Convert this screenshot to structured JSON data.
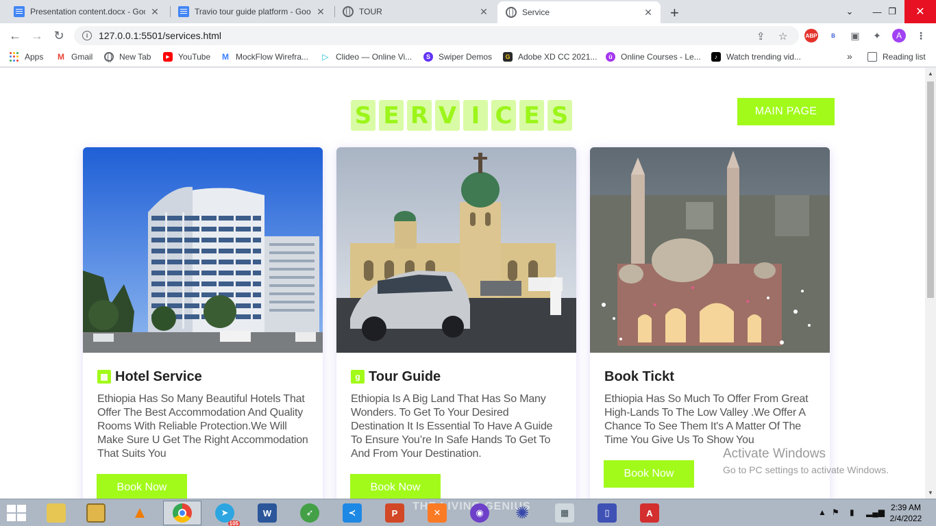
{
  "browser": {
    "tabs": [
      {
        "title": "Presentation content.docx - Goo",
        "favicon": "google-docs-icon",
        "active": false
      },
      {
        "title": "Travio tour guide platform - Goo",
        "favicon": "google-docs-icon",
        "active": false
      },
      {
        "title": "TOUR",
        "favicon": "globe-icon",
        "active": false
      },
      {
        "title": "Service",
        "favicon": "globe-icon",
        "active": true
      }
    ],
    "url": "127.0.0.1:5501/services.html",
    "profile_initial": "A",
    "bookmarks": [
      {
        "label": "Apps",
        "icon": "apps-grid-icon"
      },
      {
        "label": "Gmail",
        "icon": "gmail-icon"
      },
      {
        "label": "New Tab",
        "icon": "globe-icon"
      },
      {
        "label": "YouTube",
        "icon": "youtube-icon"
      },
      {
        "label": "MockFlow Wirefra...",
        "icon": "mockflow-icon"
      },
      {
        "label": "Clideo — Online Vi...",
        "icon": "clideo-icon"
      },
      {
        "label": "Swiper Demos",
        "icon": "swiper-icon"
      },
      {
        "label": "Adobe XD CC 2021...",
        "icon": "adobe-xd-icon"
      },
      {
        "label": "Online Courses - Le...",
        "icon": "udemy-icon"
      },
      {
        "label": "Watch trending vid...",
        "icon": "tiktok-icon"
      }
    ],
    "reading_list": "Reading list",
    "more_bookmarks": "»",
    "extensions": {
      "abp": "ABP",
      "b": "B"
    }
  },
  "page": {
    "title_letters": [
      "S",
      "E",
      "R",
      "V",
      "I",
      "C",
      "E",
      "S"
    ],
    "main_page_button": "MAIN PAGE",
    "cards": [
      {
        "icon": "hotel-icon",
        "title": "Hotel Service",
        "text": "Ethiopia Has So Many Beautiful Hotels That Offer The Best Accommodation And Quality Rooms With Reliable Protection.We Will Make Sure U Get The Right Accommodation That Suits You",
        "button": "Book Now",
        "image": "hotel-building-photo"
      },
      {
        "icon": "tour-guide-icon",
        "title": "Tour Guide",
        "text": "Ethiopia Is A Big Land That Has So Many Wonders. To Get To Your Desired Destination It Is Essential To Have A Guide To Ensure You’re In Safe Hands To Get To And From Your Destination.",
        "button": "Book Now",
        "image": "cathedral-photo"
      },
      {
        "icon": "",
        "title": "Book Tickt",
        "text": "Ethiopia Has So Much To Offer From Great High-Lands To The Low Valley .We Offer A Chance To See Them It's A Matter Of The Time You Give Us To Show You",
        "button": "Book Now",
        "image": "mosque-photo"
      }
    ]
  },
  "watermark": {
    "line1": "Activate Windows",
    "line2": "Go to PC settings to activate Windows."
  },
  "taskbar": {
    "time": "2:39 AM",
    "date": "2/4/2022",
    "telegram_badge": "105",
    "overlay_text": "THE LIVING GENIUS"
  },
  "colors": {
    "accent": "#a2fa1a",
    "title_tile": "#d9fba5",
    "title_letter": "#9cf51a"
  }
}
